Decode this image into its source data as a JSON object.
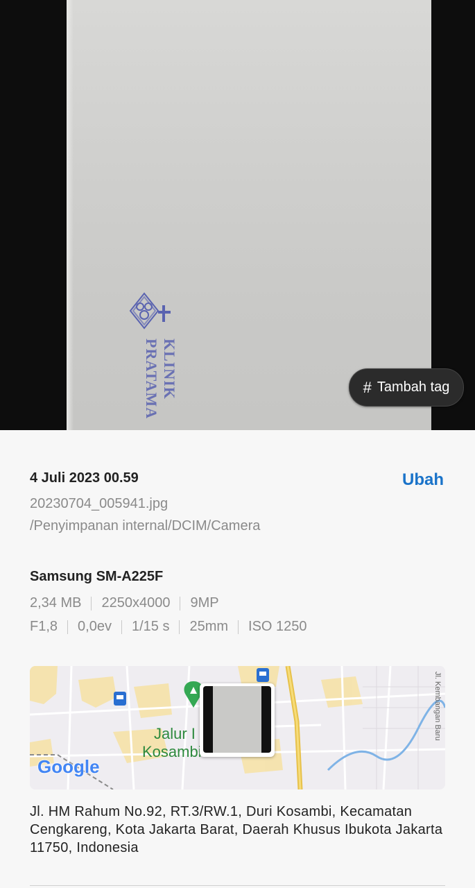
{
  "photo": {
    "stamp_text": "KLINIK PRATAMA",
    "tag_button_label": "Tambah tag",
    "tag_button_icon": "#"
  },
  "details": {
    "date": "4 Juli 2023 00.59",
    "edit_label": "Ubah",
    "filename": "20230704_005941.jpg",
    "path": "/Penyimpanan internal/DCIM/Camera",
    "device": "Samsung SM-A225F",
    "file_info": [
      "2,34 MB",
      "2250x4000",
      "9MP"
    ],
    "camera_info": [
      "F1,8",
      "0,0ev",
      "1/15 s",
      "25mm",
      "ISO 1250"
    ]
  },
  "map": {
    "place_label_line1": "Jalur I",
    "place_label_line2": "Kosambi Baru",
    "road_label": "Jl. Kembangan Baru",
    "google_logo": "Google"
  },
  "location": {
    "address": "Jl. HM Rahum No.92, RT.3/RW.1, Duri Kosambi, Kecamatan Cengkareng, Kota Jakarta Barat, Daerah Khusus Ibukota Jakarta 11750, Indonesia"
  },
  "colors": {
    "accent": "#1a73c9",
    "stamp": "#5a63b0",
    "map_park": "#34a853"
  }
}
